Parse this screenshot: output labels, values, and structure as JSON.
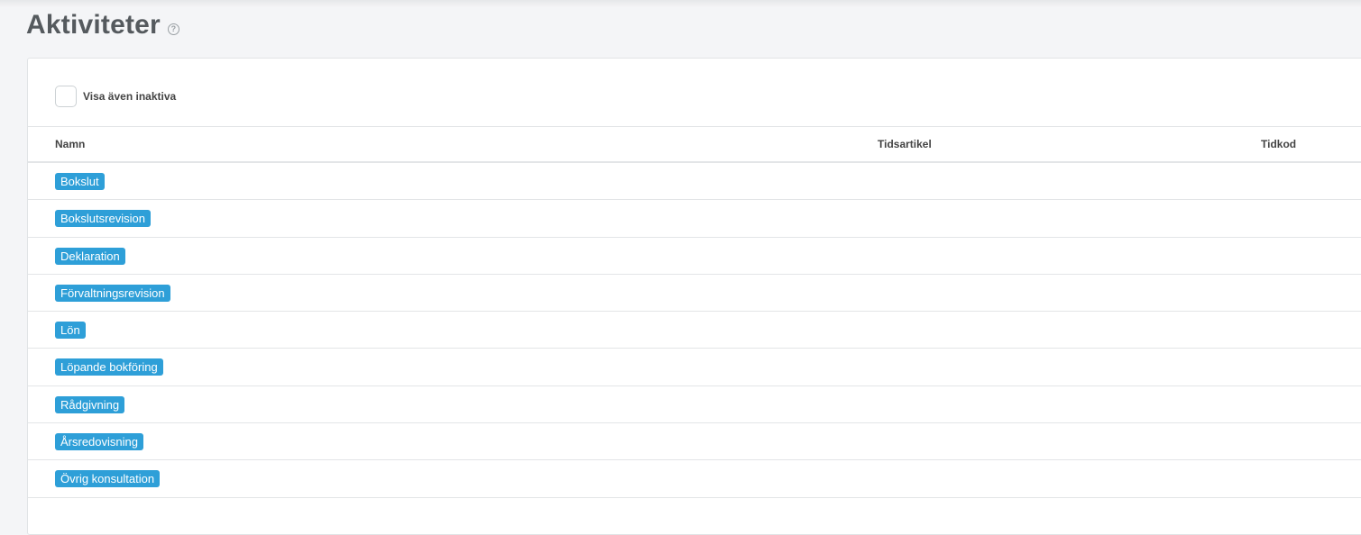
{
  "page": {
    "title": "Aktiviteter",
    "help_icon": "question-circle-icon"
  },
  "filter": {
    "show_inactive_label": "Visa även inaktiva",
    "show_inactive_checked": false
  },
  "table": {
    "columns": [
      "Namn",
      "Tidsartikel",
      "Tidkod"
    ],
    "rows": [
      {
        "name": "Bokslut",
        "tidsartikel": "",
        "tidkod": ""
      },
      {
        "name": "Bokslutsrevision",
        "tidsartikel": "",
        "tidkod": ""
      },
      {
        "name": "Deklaration",
        "tidsartikel": "",
        "tidkod": ""
      },
      {
        "name": "Förvaltningsrevision",
        "tidsartikel": "",
        "tidkod": ""
      },
      {
        "name": "Lön",
        "tidsartikel": "",
        "tidkod": ""
      },
      {
        "name": "Löpande bokföring",
        "tidsartikel": "",
        "tidkod": ""
      },
      {
        "name": "Rådgivning",
        "tidsartikel": "",
        "tidkod": ""
      },
      {
        "name": "Årsredovisning",
        "tidsartikel": "",
        "tidkod": ""
      },
      {
        "name": "Övrig konsultation",
        "tidsartikel": "",
        "tidkod": ""
      }
    ]
  },
  "colors": {
    "tag_background": "#2e9fd8",
    "page_background": "#f4f5f7"
  }
}
